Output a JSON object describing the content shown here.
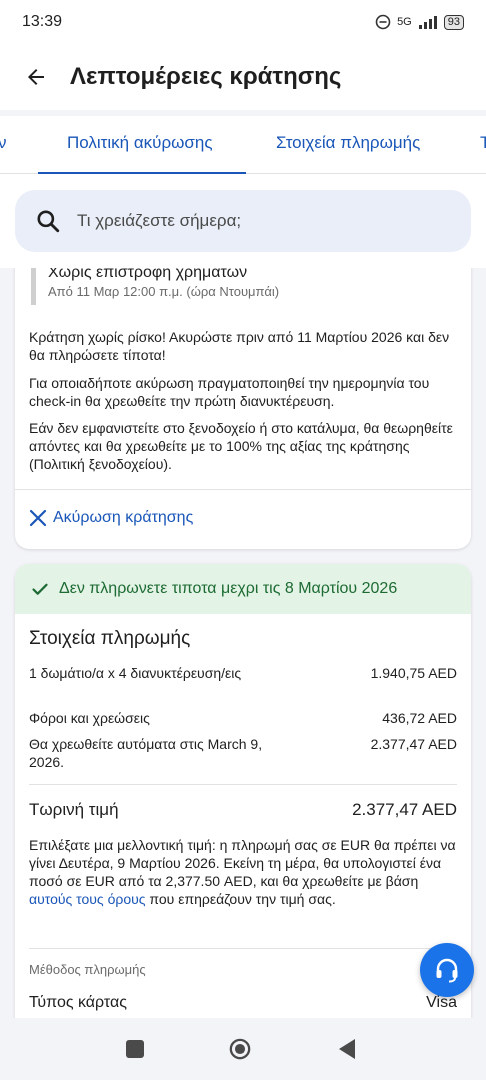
{
  "status_bar": {
    "time": "13:39",
    "network": "5G",
    "battery": "93"
  },
  "app_bar": {
    "title": "Λεπτομέρειες κράτησης",
    "back_icon": "arrow-left-icon"
  },
  "tabs": [
    {
      "label": "ν",
      "active": false
    },
    {
      "label": "Πολιτική ακύρωσης",
      "active": true
    },
    {
      "label": "Στοιχεία πληρωμής",
      "active": false
    },
    {
      "label": "Τ",
      "active": false
    }
  ],
  "search": {
    "placeholder": "Τι χρειάζεστε σήμερα;"
  },
  "cancellation": {
    "policy_title": "Χωρίς επιστροφή χρημάτων",
    "policy_sub": "Από 11 Μαρ 12:00 π.μ. (ώρα Ντουμπάι)",
    "paragraphs": [
      "Κράτηση χωρίς ρίσκο! Ακυρώστε πριν από 11 Μαρτίου 2026 και δεν θα πληρώσετε τίποτα!",
      "Για οποιαδήποτε ακύρωση πραγματοποιηθεί την ημερομηνία του check-in θα χρεωθείτε την πρώτη διανυκτέρευση.",
      "Εάν δεν εμφανιστείτε στο ξενοδοχείο ή στο κατάλυμα, θα θεωρηθείτε απόντες και θα χρεωθείτε με το 100% της αξίας της κράτησης (Πολιτική ξενοδοχείου)."
    ],
    "cancel_label": "Ακύρωση κράτησης"
  },
  "payment": {
    "banner": "Δεν πληρωνετε τιποτα μεχρι τις 8 Μαρτίου 2026",
    "heading": "Στοιχεία πληρωμής",
    "items": [
      {
        "label": "1 δωμάτιο/α x 4 διανυκτέρευση/εις",
        "value": "1.940,75 AED"
      },
      {
        "label": "Φόροι και χρεώσεις",
        "value": "436,72 AED"
      },
      {
        "label": "Θα χρεωθείτε αυτόματα στις March 9, 2026.",
        "value": "2.377,47 AED"
      }
    ],
    "total_label": "Τωρινή τιμή",
    "total_value": "2.377,47 AED",
    "note_before": "Επιλέξατε μια μελλοντική τιμή: η πληρωμή σας σε EUR θα πρέπει να γίνει Δευτέρα, 9 Μαρτίου 2026. Εκείνη τη μέρα, θα υπολογιστεί ένα ποσό σε EUR από τα 2,377.50 AED, και θα χρεωθείτε με βάση ",
    "note_link": "αυτούς τους όρους",
    "note_after": " που επηρεάζουν την τιμή σας.",
    "method_label": "Μέθοδος πληρωμής",
    "card_type_label": "Τύπος κάρτας",
    "card_type_value": "Visa"
  },
  "colors": {
    "accent": "#1a56b8",
    "banner_bg": "#e3f3e6",
    "banner_text": "#1d6b33",
    "fab": "#1a73e8"
  }
}
